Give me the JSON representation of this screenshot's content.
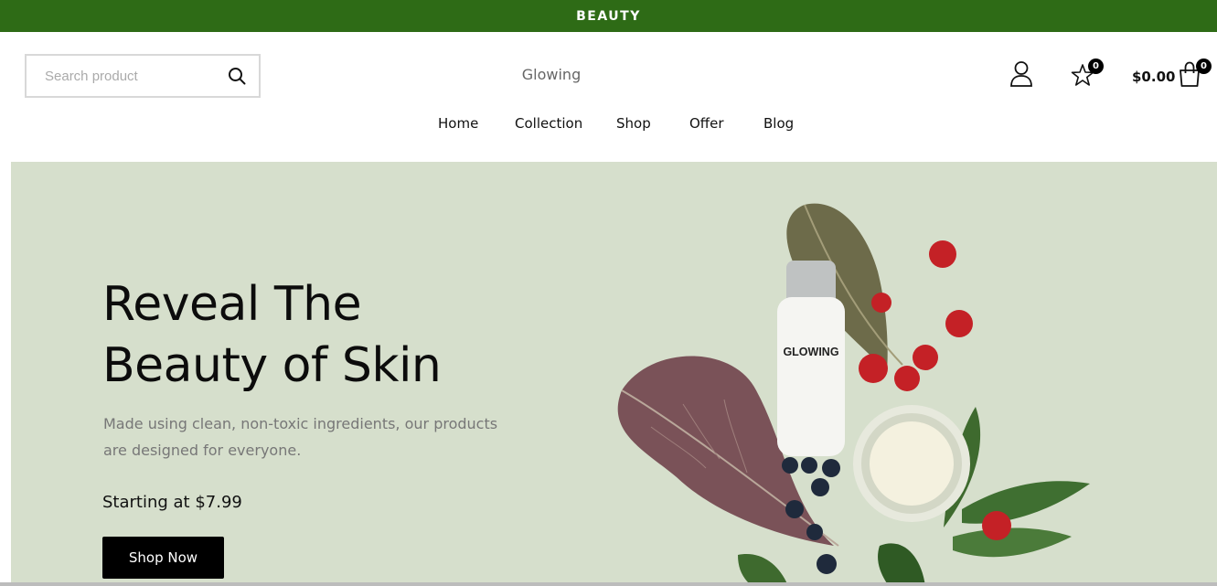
{
  "announcement": {
    "text": "BEAUTY"
  },
  "header": {
    "search": {
      "placeholder": "Search product"
    },
    "logo": "Glowing",
    "wishlist_count": "0",
    "cart_total": "$0.00",
    "cart_count": "0"
  },
  "nav": {
    "items": [
      {
        "label": "Home"
      },
      {
        "label": "Collection"
      },
      {
        "label": "Shop"
      },
      {
        "label": "Offer"
      },
      {
        "label": "Blog"
      }
    ]
  },
  "hero": {
    "title_line1": "Reveal The",
    "title_line2": "Beauty of Skin",
    "subtitle": "Made using clean, non-toxic ingredients, our products are designed for everyone.",
    "price_text": "Starting at $7.99",
    "cta_label": "Shop Now",
    "bottle_label": "GLOWING"
  },
  "colors": {
    "accent": "#2e6b16",
    "hero_bg": "#d6dfcc",
    "button": "#000000"
  },
  "icons": [
    "search-icon",
    "user-icon",
    "star-icon",
    "shopping-bag-icon"
  ]
}
